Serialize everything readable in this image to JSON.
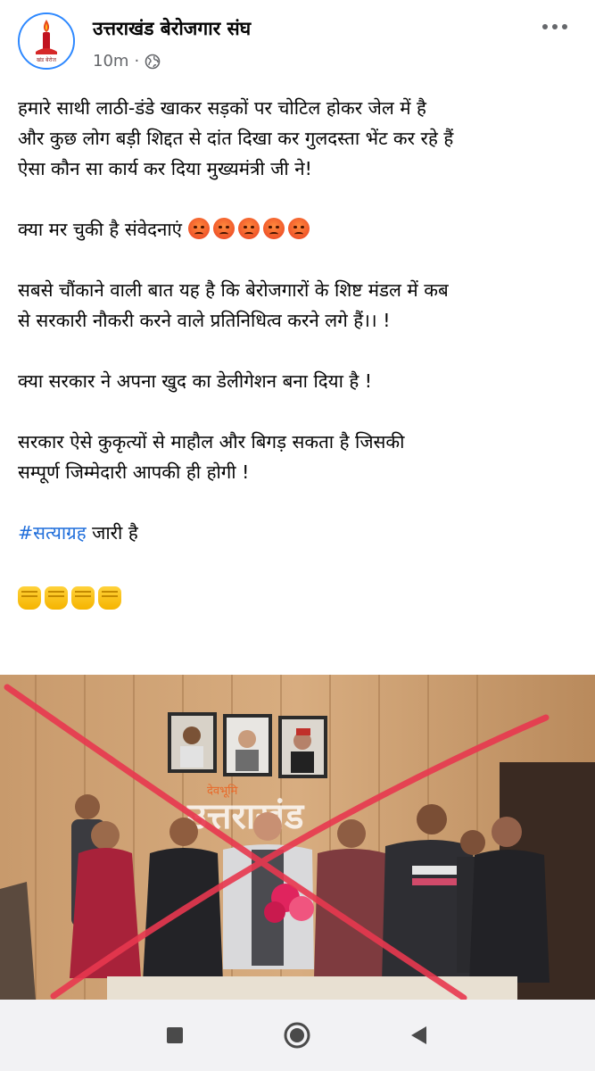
{
  "header": {
    "page_name": "उत्तराखंड बेरोजगार संघ",
    "time": "10m",
    "separator": "·",
    "privacy_icon": "globe-icon",
    "more_icon": "more-horizontal-icon",
    "avatar_caption": "खंड बेरोज"
  },
  "post": {
    "para1_line1": "हमारे साथी लाठी-डंडे खाकर सड़कों पर चोटिल होकर जेल में है",
    "para1_line2": "और कुछ लोग बड़ी शिद्दत से दांत दिखा कर गुलदस्ता भेंट कर रहे हैं",
    "para1_line3": "ऐसा कौन सा कार्य कर दिया मुख्यमंत्री जी ने!",
    "para2": "क्या मर चुकी है संवेदनाएं",
    "para3_line1": "सबसे चौंकाने वाली बात यह है कि बेरोजगारों के शिष्ट मंडल में कब",
    "para3_line2": "से सरकारी नौकरी करने वाले प्रतिनिधित्व करने लगे हैं।। !",
    "para4": "क्या सरकार ने अपना खुद का डेलीगेशन बना दिया है !",
    "para5_line1": "सरकार ऐसे कुकृत्यों से माहौल और बिगड़ सकता है  जिसकी",
    "para5_line2": "सम्पूर्ण जिम्मेदारी आपकी ही होगी !",
    "hashtag": "#सत्याग्रह",
    "hashtag_rest": " जारी है",
    "angry_emoji_count": 5,
    "fist_emoji_count": 4
  },
  "photo": {
    "wall_sign_small": "देवभूमि",
    "wall_sign_large": "उत्तराखंड",
    "cross_color": "#e8384f"
  },
  "navbar": {
    "recent_icon": "square-recents-icon",
    "home_icon": "circle-home-icon",
    "back_icon": "triangle-back-icon"
  },
  "colors": {
    "link": "#216fdb",
    "meta": "#65676b",
    "navbar_bg": "#f2f2f4"
  }
}
